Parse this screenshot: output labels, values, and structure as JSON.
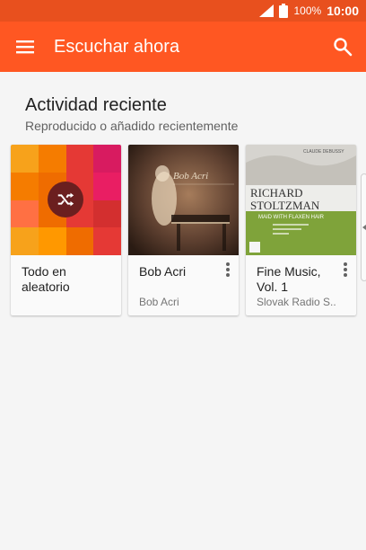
{
  "status_bar": {
    "battery": "100%",
    "time": "10:00",
    "icons": [
      "signal-icon",
      "battery-icon"
    ]
  },
  "app_bar": {
    "title": "Escuchar ahora",
    "menu_icon": "hamburger-menu-icon",
    "search_icon": "search-icon"
  },
  "section": {
    "title": "Actividad reciente",
    "subtitle": "Reproducido o añadido recientemente"
  },
  "cards": [
    {
      "title": "Todo en aleatorio",
      "subtitle": "",
      "art": "shuffle-all-art",
      "icon": "shuffle-icon"
    },
    {
      "title": "Bob Acri",
      "subtitle": "Bob Acri",
      "art": "bob-acri-album-art",
      "menu_icon": "more-vert-icon"
    },
    {
      "title": "Fine Music, Vol. 1",
      "subtitle": "Slovak Radio S..",
      "art": "fine-music-album-art",
      "menu_icon": "more-vert-icon",
      "art_text": {
        "top": "CLAUDE DEBUSSY",
        "name1": "RICHARD",
        "name2": "STOLTZMAN",
        "band": "MAID WITH FLAXEN HAIR"
      }
    }
  ],
  "colors": {
    "status_bar": "#e8501e",
    "app_bar": "#ff5722",
    "background": "#f5f5f5"
  }
}
